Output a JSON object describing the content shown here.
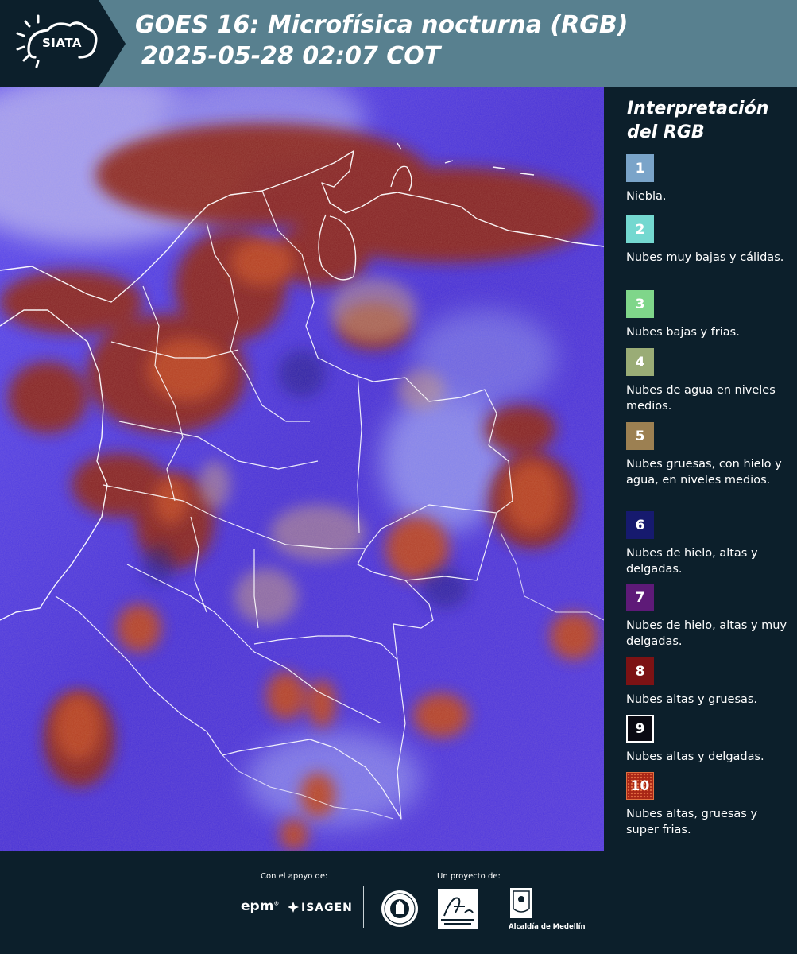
{
  "header": {
    "logo_text": "SIATA",
    "title_line1": "GOES 16: Microfísica nocturna (RGB)",
    "title_line2": "2025-05-28 02:07 COT",
    "background_color": "#58808f"
  },
  "legend": {
    "title": "Interpretación del RGB",
    "items": [
      {
        "number": "1",
        "color": "#7aa4c9",
        "label": "Niebla."
      },
      {
        "number": "2",
        "color": "#74d8d0",
        "label": "Nubes muy bajas y cálidas."
      },
      {
        "number": "3",
        "color": "#7fd68a",
        "label": "Nubes bajas y frias."
      },
      {
        "number": "4",
        "color": "#9aac76",
        "label": "Nubes de agua en niveles medios."
      },
      {
        "number": "5",
        "color": "#9c8052",
        "label": "Nubes gruesas, con hielo y agua, en niveles medios."
      },
      {
        "number": "6",
        "color": "#161a6e",
        "label": "Nubes de hielo, altas y delgadas."
      },
      {
        "number": "7",
        "color": "#5e1a78",
        "label": "Nubes de hielo, altas y muy delgadas."
      },
      {
        "number": "8",
        "color": "#7c1214",
        "label": "Nubes altas y gruesas."
      },
      {
        "number": "9",
        "color": "#0a0a12",
        "label": "Nubes altas y delgadas."
      },
      {
        "number": "10",
        "color": "#a82616",
        "label": "Nubes altas, gruesas y super frias."
      }
    ]
  },
  "footer": {
    "support_label": "Con el apoyo de:",
    "project_label": "Un proyecto de:",
    "epm_text": "epm",
    "isagen_text": "ISAGEN",
    "medellin_text": "Alcaldía de Medellín"
  }
}
